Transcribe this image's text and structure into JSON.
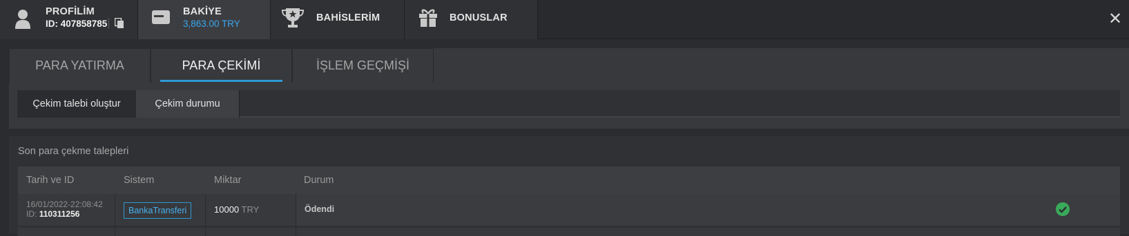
{
  "top_tabs": [
    {
      "title": "PROFİLİM",
      "sub": "ID: 407858785",
      "icon": "user-icon"
    },
    {
      "title": "BAKİYE",
      "sub": "3,863.00 TRY",
      "icon": "wallet-icon"
    },
    {
      "title": "BAHİSLERİM",
      "icon": "trophy-icon"
    },
    {
      "title": "BONUSLAR",
      "icon": "gift-icon"
    }
  ],
  "close_label": "✕",
  "section_tabs": [
    "PARA YATIRMA",
    "PARA ÇEKİMİ",
    "İŞLEM GEÇMİŞİ"
  ],
  "inner_tabs": [
    "Çekim talebi oluştur",
    "Çekim durumu"
  ],
  "list": {
    "title": "Son para çekme talepleri",
    "headers": [
      "Tarih ve ID",
      "Sistem",
      "Miktar",
      "Durum"
    ],
    "rows": [
      {
        "date": "16/01/2022-22:08:42",
        "id_label": "ID:",
        "id": "110311256",
        "system": "BankaTransferi",
        "amount": "10000",
        "currency": "TRY",
        "status": "Ödendi"
      }
    ]
  },
  "colors": {
    "accent": "#2e9ad6",
    "success": "#39a95a",
    "balance": "#3aa7ee"
  }
}
